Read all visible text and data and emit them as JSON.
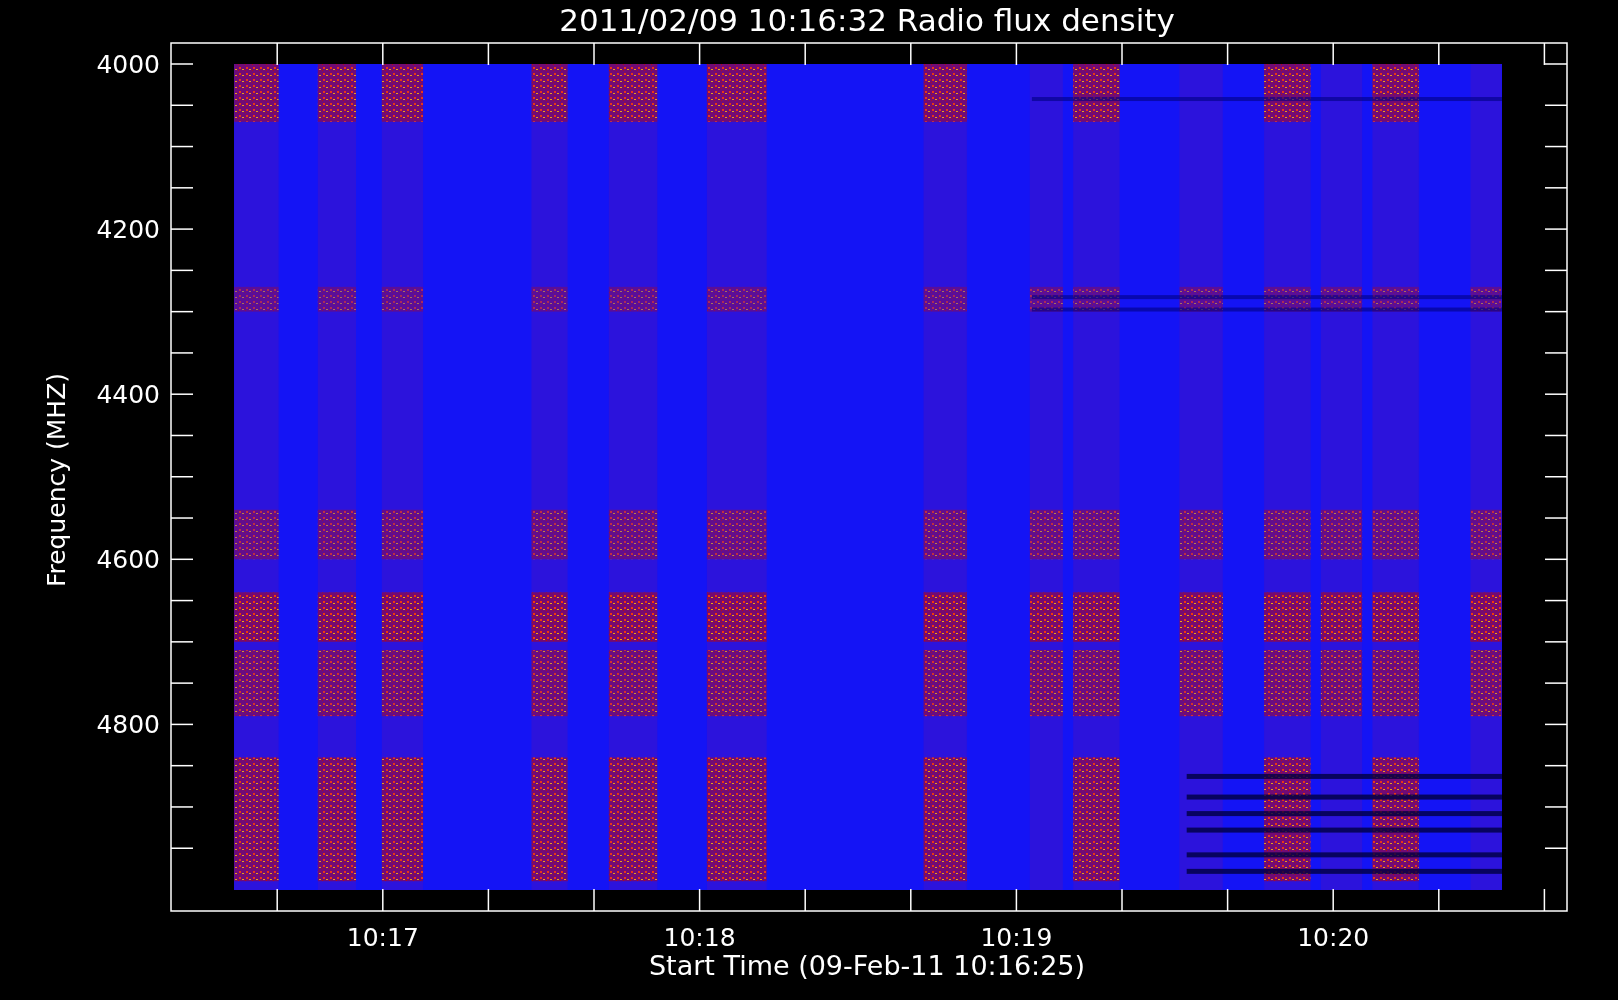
{
  "title": "2011/02/09 10:16:32 Radio flux density",
  "y_axis": {
    "label": "Frequency (MHZ)",
    "tick_labels": [
      "4000",
      "4200",
      "4400",
      "4600",
      "4800"
    ]
  },
  "x_axis": {
    "label": "Start Time (09-Feb-11 10:16:25)",
    "tick_labels": [
      "10:17",
      "10:18",
      "10:19",
      "10:20"
    ]
  }
}
